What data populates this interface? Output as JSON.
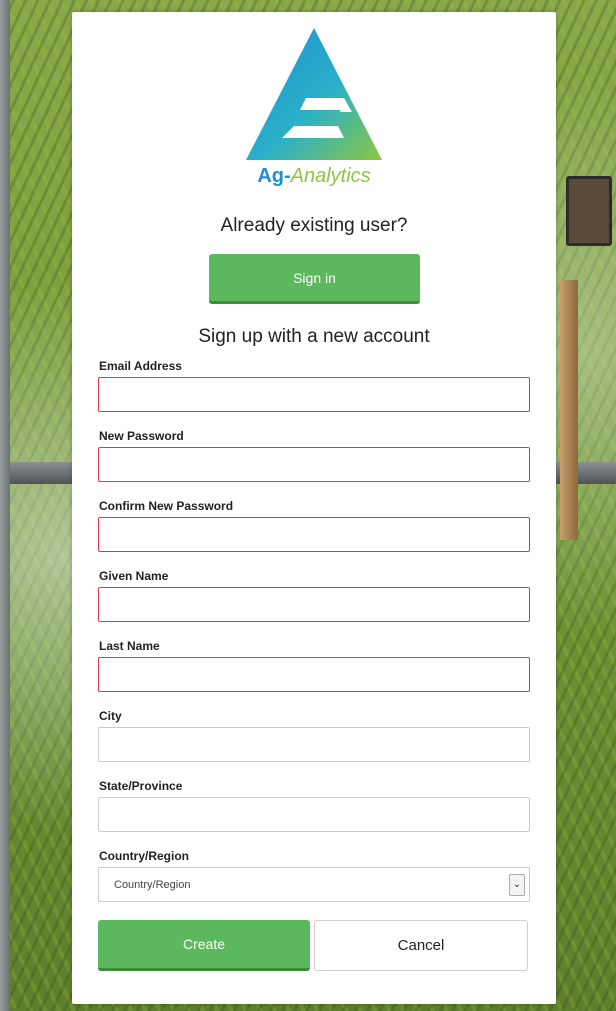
{
  "brand": {
    "name_part1": "Ag-",
    "name_part2": "Analytics",
    "colors": {
      "blue": "#1f8fd4",
      "green": "#8cc63f"
    }
  },
  "existing_user": {
    "prompt": "Already existing user?",
    "signin_label": "Sign in"
  },
  "signup": {
    "title": "Sign up with a new account",
    "fields": [
      {
        "label": "Email Address",
        "value": "",
        "state": "error"
      },
      {
        "label": "New Password",
        "value": "",
        "state": "error"
      },
      {
        "label": "Confirm New Password",
        "value": "",
        "state": "error"
      },
      {
        "label": "Given Name",
        "value": "",
        "state": "error"
      },
      {
        "label": "Last Name",
        "value": "",
        "state": "error"
      },
      {
        "label": "City",
        "value": "",
        "state": "normal"
      },
      {
        "label": "State/Province",
        "value": "",
        "state": "normal"
      }
    ],
    "country": {
      "label": "Country/Region",
      "selected": "Country/Region"
    },
    "create_label": "Create",
    "cancel_label": "Cancel"
  },
  "colors": {
    "primary_button": "#5cb85c",
    "error_border": "#e03a3a"
  }
}
